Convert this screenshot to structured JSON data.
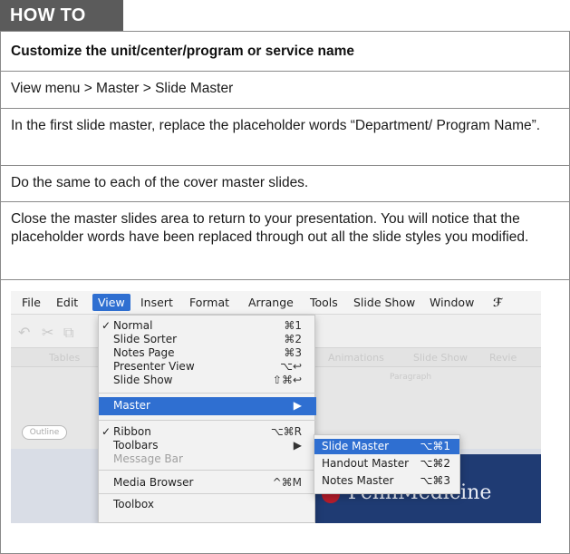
{
  "tab_label": "HOW TO",
  "heading": "Customize the unit/center/program or service name",
  "steps": [
    "View menu > Master > Slide Master",
    "In the first slide master, replace the placeholder words “Department/ Program Name”.",
    "Do the same to each of the cover master slides.",
    "Close the master slides area to return to your presentation. You will notice that the placeholder words have been replaced through out all the slide styles you modified."
  ],
  "screenshot": {
    "menubar": [
      "File",
      "Edit",
      "View",
      "Insert",
      "Format",
      "Arrange",
      "Tools",
      "Slide Show",
      "Window"
    ],
    "menubar_active": "View",
    "view_menu": [
      {
        "label": "Normal",
        "shortcut": "⌘1",
        "checked": true
      },
      {
        "label": "Slide Sorter",
        "shortcut": "⌘2"
      },
      {
        "label": "Notes Page",
        "shortcut": "⌘3"
      },
      {
        "label": "Presenter View",
        "shortcut": "⌥↩"
      },
      {
        "label": "Slide Show",
        "shortcut": "⇧⌘↩"
      },
      {
        "label": "Master",
        "shortcut": "▶"
      },
      {
        "label": "Ribbon",
        "shortcut": "⌥⌘R",
        "checked": true
      },
      {
        "label": "Toolbars",
        "shortcut": "▶"
      },
      {
        "label": "Message Bar",
        "shortcut": ""
      },
      {
        "label": "Media Browser",
        "shortcut": "^⌘M"
      },
      {
        "label": "Toolbox",
        "shortcut": ""
      }
    ],
    "master_submenu": [
      {
        "label": "Slide Master",
        "shortcut": "⌥⌘1"
      },
      {
        "label": "Handout Master",
        "shortcut": "⌥⌘2"
      },
      {
        "label": "Notes Master",
        "shortcut": "⌥⌘3"
      }
    ],
    "ghost_labels": [
      "Tables",
      "Animations",
      "Slide Show",
      "Revie",
      "Paragraph",
      "Outline"
    ],
    "slide_brand": "PennMedicine",
    "accent_color": "#2f6fd1"
  }
}
